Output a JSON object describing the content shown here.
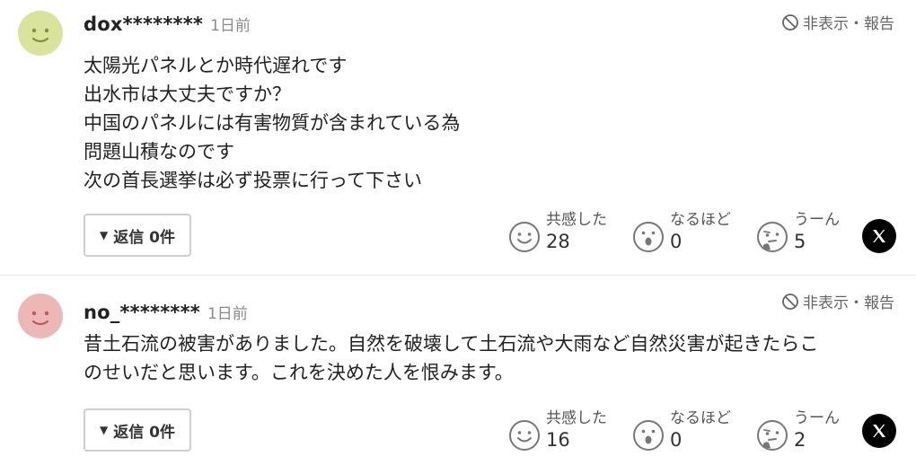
{
  "comments": [
    {
      "username": "dox********",
      "timestamp": "1日前",
      "hide_report": "非表示・報告",
      "avatar_color": "#d9e39c",
      "body_lines": [
        "太陽光パネルとか時代遅れです",
        "出水市は大丈夫ですか？",
        "中国のパネルには有害物質が含まれている為",
        "問題山積なのです",
        "次の首長選挙は必ず投票に行って下さい"
      ],
      "reply_label": "返信 0件",
      "reactions": [
        {
          "icon": "smile-face-icon",
          "label": "共感した",
          "count": "28"
        },
        {
          "icon": "surprised-face-icon",
          "label": "なるほど",
          "count": "0"
        },
        {
          "icon": "thinking-face-icon",
          "label": "うーん",
          "count": "5"
        }
      ],
      "share_icon": "x-logo-icon"
    },
    {
      "username": "no_********",
      "timestamp": "1日前",
      "hide_report": "非表示・報告",
      "avatar_color": "#ecb7b7",
      "body_lines": [
        "昔土石流の被害がありました。自然を破壊して土石流や大雨など自然災害が起きたらこ",
        "のせいだと思います。これを決めた人を恨みます。"
      ],
      "reply_label": "返信 0件",
      "reactions": [
        {
          "icon": "smile-face-icon",
          "label": "共感した",
          "count": "16"
        },
        {
          "icon": "surprised-face-icon",
          "label": "なるほど",
          "count": "0"
        },
        {
          "icon": "thinking-face-icon",
          "label": "うーん",
          "count": "2"
        }
      ],
      "share_icon": "x-logo-icon"
    }
  ]
}
